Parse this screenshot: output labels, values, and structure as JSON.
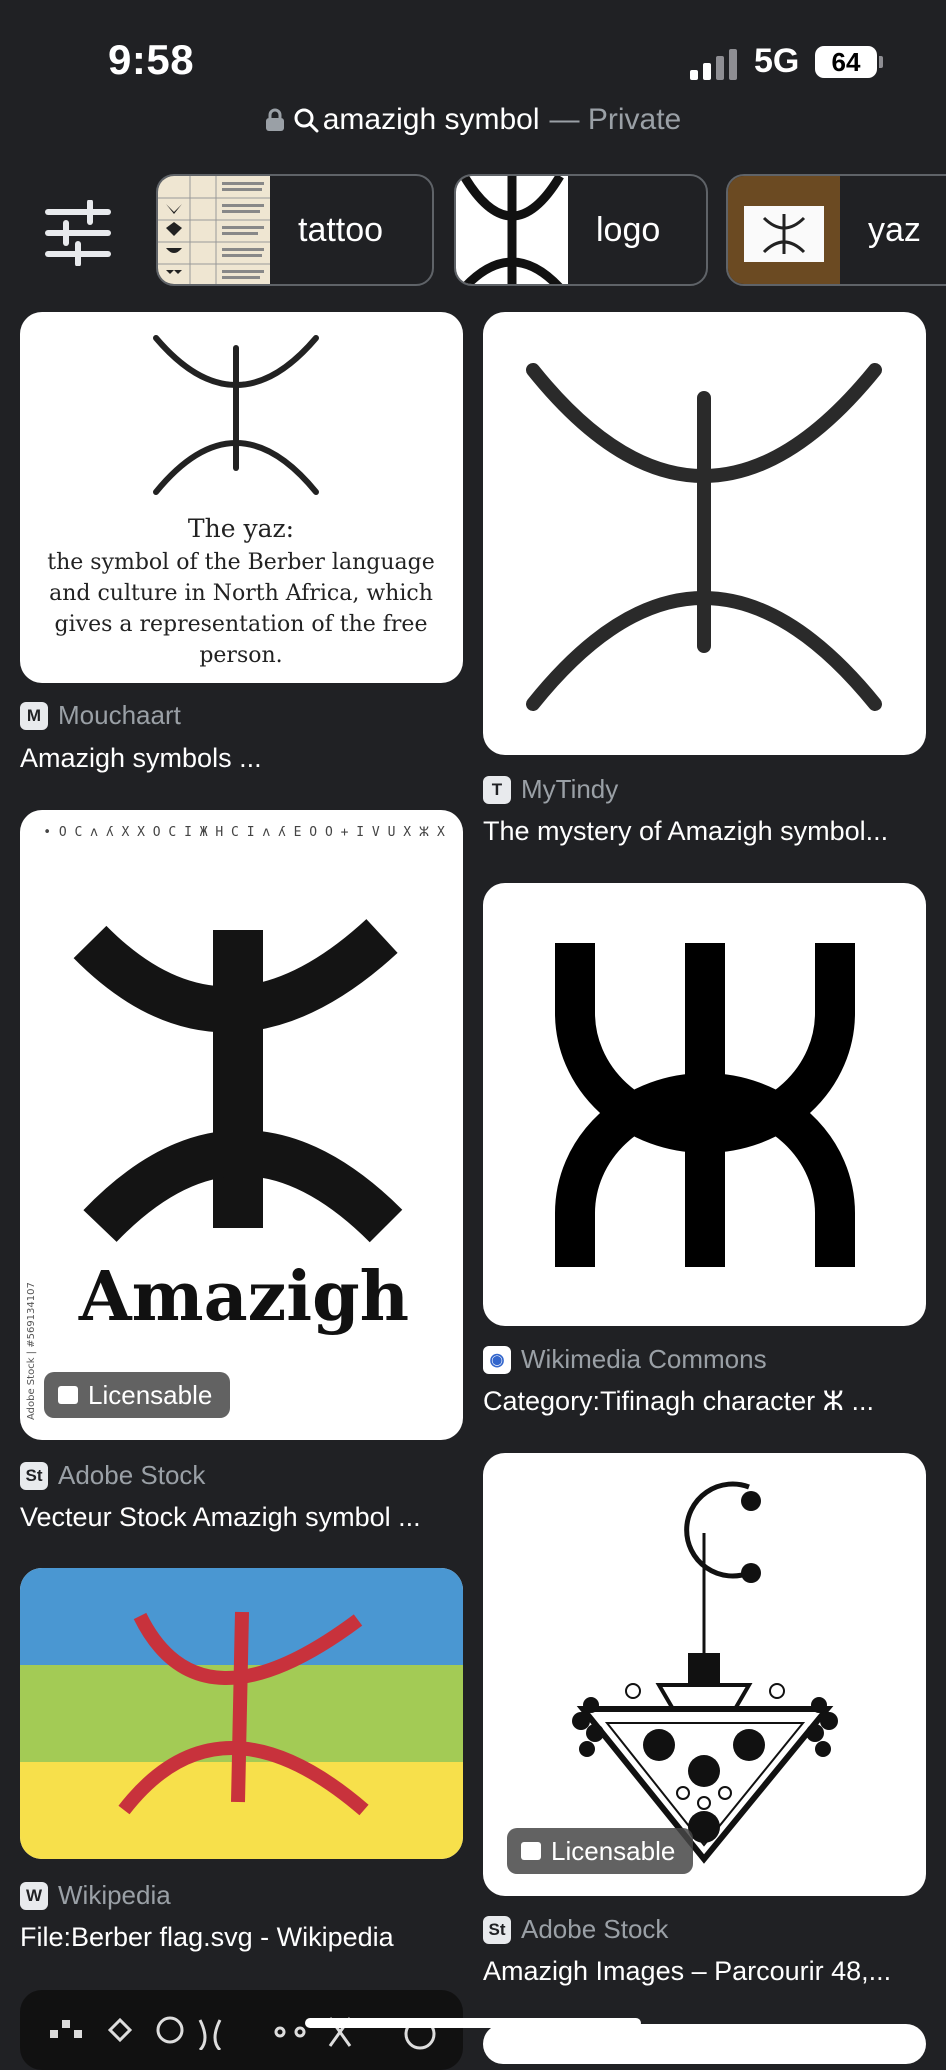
{
  "status": {
    "time": "9:58",
    "network": "5G",
    "battery": "64"
  },
  "address_bar": {
    "query": "amazigh symbol",
    "mode": "— Private"
  },
  "chips": [
    {
      "label": "tattoo"
    },
    {
      "label": "logo"
    },
    {
      "label": "yaz"
    }
  ],
  "results": [
    {
      "source": "Mouchaart",
      "title": "Amazigh symbols ...",
      "caption": [
        "The yaz:",
        "the symbol of the Berber language",
        "and culture in North Africa, which",
        "gives a representation of the free",
        "person."
      ]
    },
    {
      "source": "MyTindy",
      "title": "The mystery of Amazigh symbol..."
    },
    {
      "source": "Adobe Stock",
      "title": "Vecteur Stock Amazigh symbol ...",
      "image_text": "Amazigh",
      "badge": "Licensable",
      "top_strip": "• O C ʌ ʎ X X O C I Ж H C I ʌ ʎ E O O + I V U X ⵣ X",
      "side_text": "Adobe Stock | #569134107"
    },
    {
      "source": "Wikimedia Commons",
      "title": "Category:Tifinagh character ⵣ ..."
    },
    {
      "source": "Wikipedia",
      "title": "File:Berber flag.svg - Wikipedia"
    },
    {
      "source": "Adobe Stock",
      "title": "Amazigh Images – Parcourir 48,...",
      "badge": "Licensable"
    }
  ],
  "colors": {
    "background": "#202124",
    "flag_blue": "#4a97d2",
    "flag_green": "#a3cb55",
    "flag_yellow": "#f7e04b",
    "flag_red": "#c8323c"
  }
}
